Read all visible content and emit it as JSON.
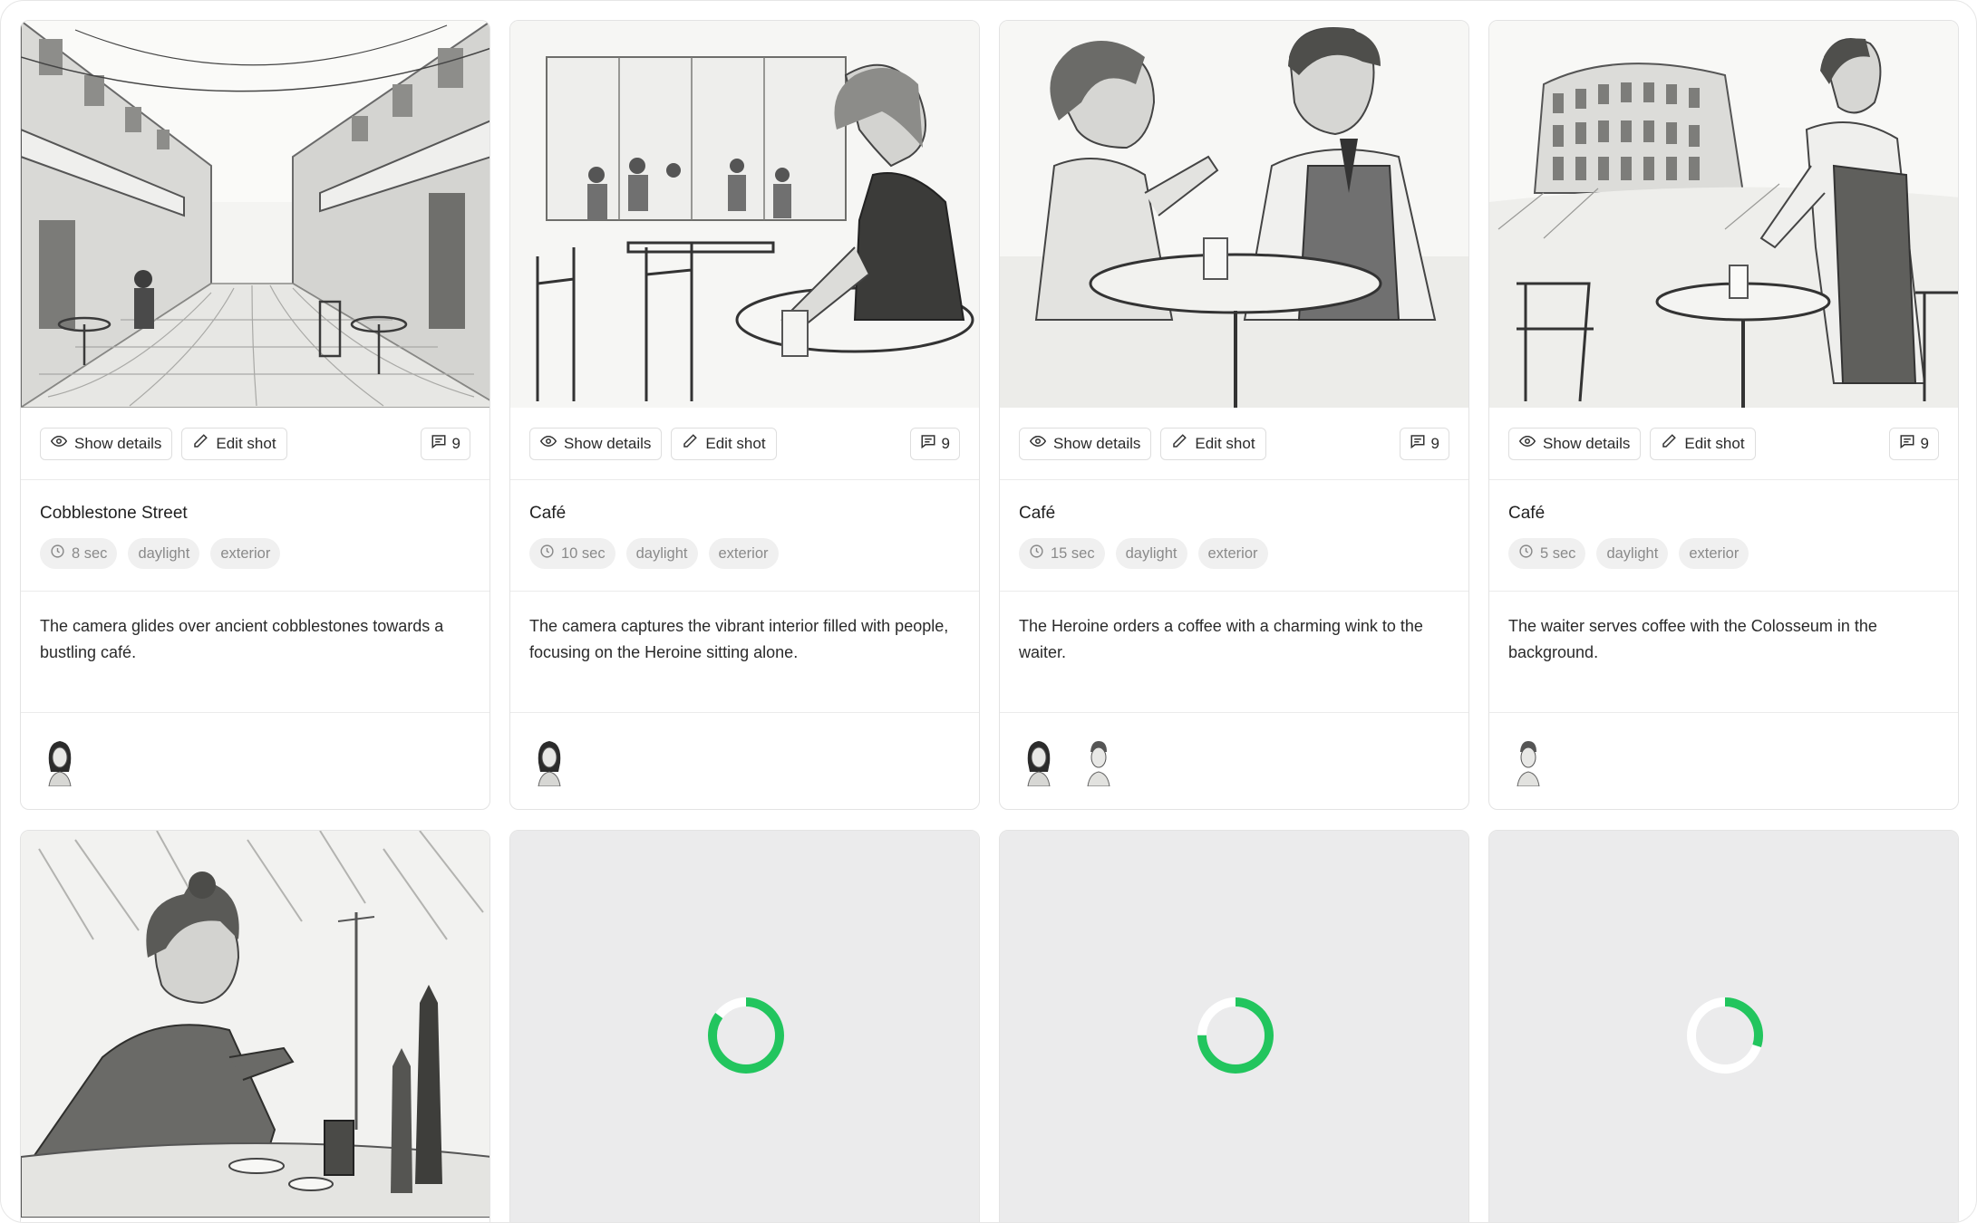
{
  "actions": {
    "show_details": "Show details",
    "edit_shot": "Edit shot"
  },
  "colors": {
    "spinner": "#22c55e",
    "spinner_track": "#ffffff"
  },
  "shots": [
    {
      "title": "Cobblestone Street",
      "duration": "8 sec",
      "tags": [
        "daylight",
        "exterior"
      ],
      "comments": "9",
      "description": "The camera glides over ancient cobblestones towards a bustling café.",
      "cast": [
        "heroine"
      ]
    },
    {
      "title": "Café",
      "duration": "10 sec",
      "tags": [
        "daylight",
        "exterior"
      ],
      "comments": "9",
      "description": "The camera captures the vibrant interior filled with people, focusing on the Heroine sitting alone.",
      "cast": [
        "heroine"
      ]
    },
    {
      "title": "Café",
      "duration": "15 sec",
      "tags": [
        "daylight",
        "exterior"
      ],
      "comments": "9",
      "description": "The Heroine orders a coffee with a charming wink to the waiter.",
      "cast": [
        "heroine",
        "waiter"
      ]
    },
    {
      "title": "Café",
      "duration": "5 sec",
      "tags": [
        "daylight",
        "exterior"
      ],
      "comments": "9",
      "description": "The waiter serves coffee with the Colosseum in the background.",
      "cast": [
        "waiter"
      ]
    }
  ],
  "generating": [
    {
      "progress": 0.85
    },
    {
      "progress": 0.75
    },
    {
      "progress": 0.3
    }
  ]
}
